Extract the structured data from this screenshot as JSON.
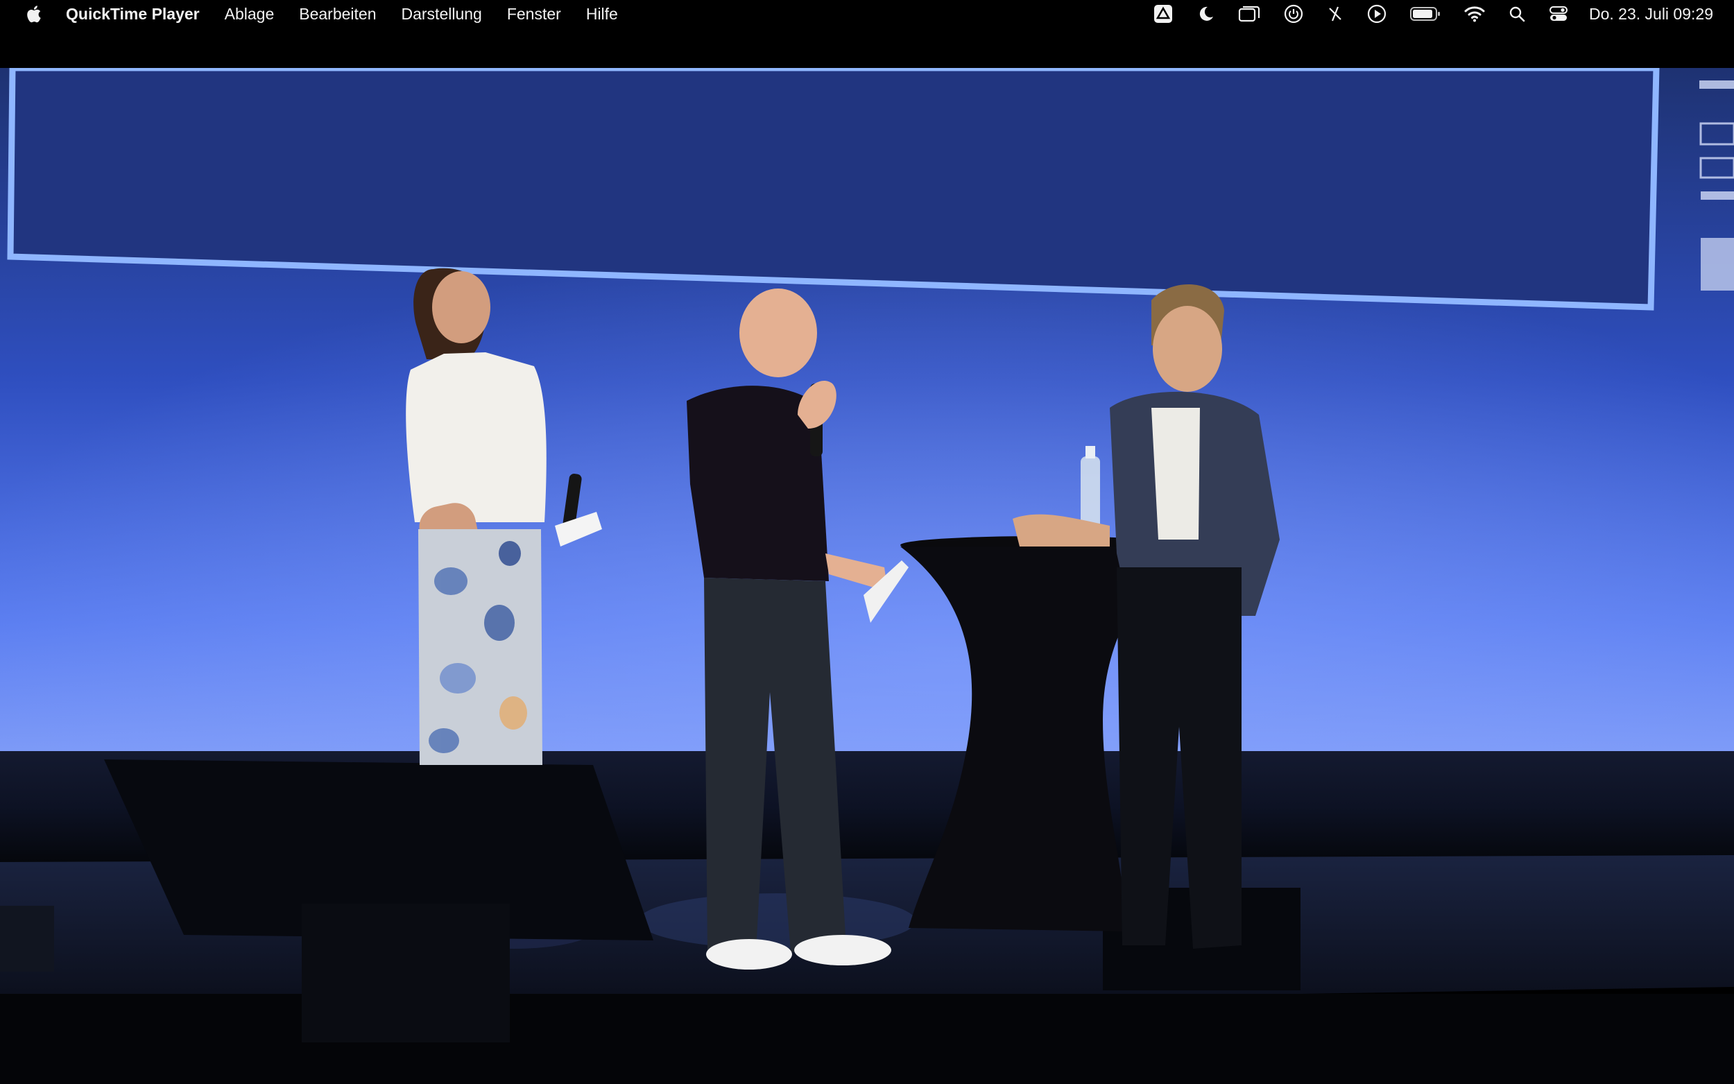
{
  "menubar": {
    "app_name": "QuickTime Player",
    "menus": [
      "Ablage",
      "Bearbeiten",
      "Darstellung",
      "Fenster",
      "Hilfe"
    ],
    "status_icons": [
      "drive-icon",
      "moon-icon",
      "window-stack-icon",
      "power-icon",
      "pen-slash-icon",
      "play-circle-icon",
      "battery-icon",
      "wifi-icon",
      "search-icon",
      "control-center-icon"
    ],
    "clock": "Do. 23. Juli  09:29"
  },
  "video": {
    "description_colors": {
      "screen_top": "#1f3478",
      "screen_bottom": "#6a8cf2",
      "stage": "#0b0f1c"
    }
  }
}
